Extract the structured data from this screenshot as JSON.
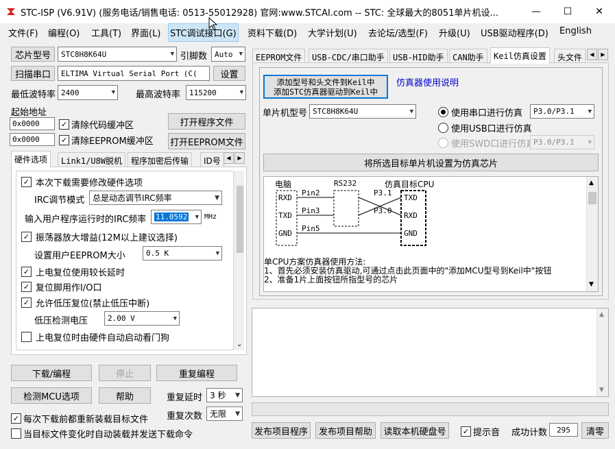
{
  "window": {
    "title": "STC-ISP (V6.91V) (服务电话/销售电话: 0513-55012928) 官网:www.STCAI.com  -- STC: 全球最大的8051单片机设...",
    "minimize": "—",
    "maximize": "☐",
    "close": "✕"
  },
  "menu": [
    "文件(F)",
    "编程(O)",
    "工具(T)",
    "界面(L)",
    "STC调试接口(G)",
    "资料下载(D)",
    "大学计划(U)",
    "去论坛/选型(F)",
    "升级(U)",
    "USB驱动程序(D)",
    "English"
  ],
  "left": {
    "chip_btn": "芯片型号",
    "chip_value": "STC8H8K64U",
    "pins_label": "引脚数",
    "pins_value": "Auto",
    "scan_btn": "扫描串口",
    "port_value": "ELTIMA Virtual Serial Port (C(",
    "settings_btn": "设置",
    "min_baud_label": "最低波特率",
    "min_baud_value": "2400",
    "max_baud_label": "最高波特率",
    "max_baud_value": "115200",
    "start_addr_label": "起始地址",
    "addr1": "0x0000",
    "clear_code_label": "清除代码缓冲区",
    "open_prog_btn": "打开程序文件",
    "addr2": "0x0000",
    "clear_eeprom_label": "清除EEPROM缓冲区",
    "open_eeprom_btn": "打开EEPROM文件",
    "tabs": [
      "硬件选项",
      "Link1/U8W脱机",
      "程序加密后传输",
      "ID号"
    ],
    "hw": {
      "modify_label": "本次下载需要修改硬件选项",
      "irc_mode_label": "IRC调节模式",
      "irc_mode_value": "总是动态调节IRC频率",
      "irc_freq_label": "输入用户程序运行时的IRC频率",
      "irc_freq_value": "11.0592",
      "irc_freq_unit": "MHz",
      "osc_label": "振荡器放大增益(12M以上建议选择)",
      "eeprom_size_label": "设置用户EEPROM大小",
      "eeprom_size_value": "0.5 K",
      "por_delay_label": "上电复位使用较长延时",
      "reset_io_label": "复位脚用作I/O口",
      "lvr_label": "允许低压复位(禁止低压中断)",
      "lv_detect_label": "低压检测电压",
      "lv_detect_value": "2.00 V",
      "wdt_label": "上电复位时由硬件自动启动看门狗"
    },
    "download_btn": "下载/编程",
    "stop_btn": "停止",
    "reprogram_btn": "重复编程",
    "check_mcu_btn": "检测MCU选项",
    "help_btn": "帮助",
    "repeat_delay_label": "重复延时",
    "repeat_delay_value": "3 秒",
    "repeat_count_label": "重复次数",
    "repeat_count_value": "无限",
    "reload_label": "每次下载前都重新装载目标文件",
    "auto_label": "当目标文件变化时自动装载并发送下载命令"
  },
  "right": {
    "tabs": [
      "EEPROM文件",
      "USB-CDC/串口助手",
      "USB-HID助手",
      "CAN助手",
      "Keil仿真设置",
      "头文件"
    ],
    "add_keil_btn_line1": "添加型号和头文件到Keil中",
    "add_keil_btn_line2": "添加STC仿真器驱动到Keil中",
    "emu_link": "仿真器使用说明",
    "mcu_label": "单片机型号",
    "mcu_value": "STC8H8K64U",
    "radio_serial": "使用串口进行仿真",
    "radio_serial_value": "P3.0/P3.1",
    "radio_usb": "使用USB口进行仿真",
    "radio_swd": "使用SWD口进行仿真",
    "radio_swd_value": "P3.0/P3.1",
    "set_chip_btn": "将所选目标单片机设置为仿真芯片",
    "diagram": {
      "pc": "电脑",
      "rs232": "RS232",
      "target": "仿真目标CPU",
      "rxd": "RXD",
      "txd": "TXD",
      "gnd": "GND",
      "pin2": "Pin2",
      "pin3": "Pin3",
      "pin5": "Pin5",
      "p31": "P3.1",
      "p30": "P3.0"
    },
    "desc1": "单CPU方案仿真器使用方法:",
    "desc2": "1、首先必须安装仿真驱动,可通过点击此页面中的\"添加MCU型号到Keil中\"按钮",
    "desc3": "2、准备1片上面按钮所指型号的芯片",
    "publish_prog_btn": "发布项目程序",
    "publish_help_btn": "发布项目帮助",
    "read_disk_btn": "读取本机硬盘号",
    "beep_label": "提示音",
    "success_label": "成功计数",
    "success_value": "295",
    "clear_btn": "清零"
  },
  "colors": {
    "accent": "#0078d7",
    "selected": "#0078d7"
  }
}
